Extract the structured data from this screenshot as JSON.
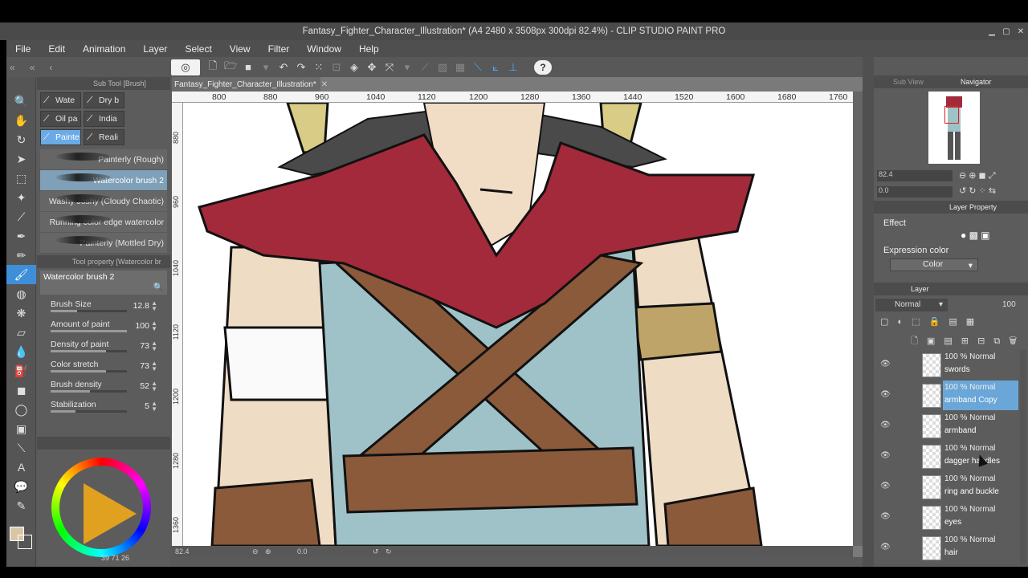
{
  "window": {
    "title": "Fantasy_Fighter_Character_Illustration* (A4 2480 x 3508px 300dpi 82.4%) - CLIP STUDIO PAINT PRO"
  },
  "menu": [
    "File",
    "Edit",
    "Animation",
    "Layer",
    "Select",
    "View",
    "Filter",
    "Window",
    "Help"
  ],
  "subtool": {
    "panel_label": "Sub Tool [Brush]",
    "tabs": [
      "Wate",
      "Dry b",
      "Oil pa",
      "India",
      "Painte",
      "Reali"
    ],
    "active_tab": 4,
    "brushes": [
      "Painterly (Rough)",
      "Watercolor brush 2",
      "Washy Joshy (Cloudy Chaotic)",
      "Running color edge watercolor",
      "Painterly (Mottled Dry)"
    ],
    "active_brush": 1
  },
  "toolprop": {
    "panel_label": "Tool property [Watercolor br",
    "brush_name": "Watercolor brush 2",
    "rows": [
      {
        "label": "Brush Size",
        "value": "12.8",
        "fill": 0.35
      },
      {
        "label": "Amount of paint",
        "value": "100",
        "fill": 1.0
      },
      {
        "label": "Density of paint",
        "value": "73",
        "fill": 0.73
      },
      {
        "label": "Color stretch",
        "value": "73",
        "fill": 0.73
      },
      {
        "label": "Brush density",
        "value": "52",
        "fill": 0.52
      },
      {
        "label": "Stabilization",
        "value": "5",
        "fill": 0.33
      }
    ]
  },
  "color": {
    "readout": "39  71  26",
    "main_color": "#d9c6a8"
  },
  "canvas": {
    "doc_tab": "Fantasy_Fighter_Character_Illustration*",
    "ruler_top": [
      "800",
      "880",
      "960",
      "1040",
      "1120",
      "1200",
      "1280",
      "1360",
      "1440",
      "1520",
      "1600",
      "1680",
      "1760"
    ],
    "ruler_left": [
      "880",
      "960",
      "1040",
      "1120",
      "1200",
      "1280",
      "1360"
    ],
    "zoom": "82.4",
    "angle": "0.0"
  },
  "navigator": {
    "tabs": [
      "Sub View",
      "Navigator"
    ],
    "zoom": "82.4",
    "angle": "0.0"
  },
  "layer_property": {
    "tab": "Layer Property",
    "effect_label": "Effect",
    "expression_label": "Expression color",
    "expression_value": "Color"
  },
  "layers": {
    "tab": "Layer",
    "blend_mode": "Normal",
    "opacity": "100",
    "items": [
      {
        "mode": "100 % Normal",
        "name": "swords"
      },
      {
        "mode": "100 % Normal",
        "name": "armband Copy"
      },
      {
        "mode": "100 % Normal",
        "name": "armband"
      },
      {
        "mode": "100 % Normal",
        "name": "dagger handles"
      },
      {
        "mode": "100 % Normal",
        "name": "ring and buckle"
      },
      {
        "mode": "100 % Normal",
        "name": "eyes"
      },
      {
        "mode": "100 % Normal",
        "name": "hair"
      }
    ],
    "selected": 1
  }
}
